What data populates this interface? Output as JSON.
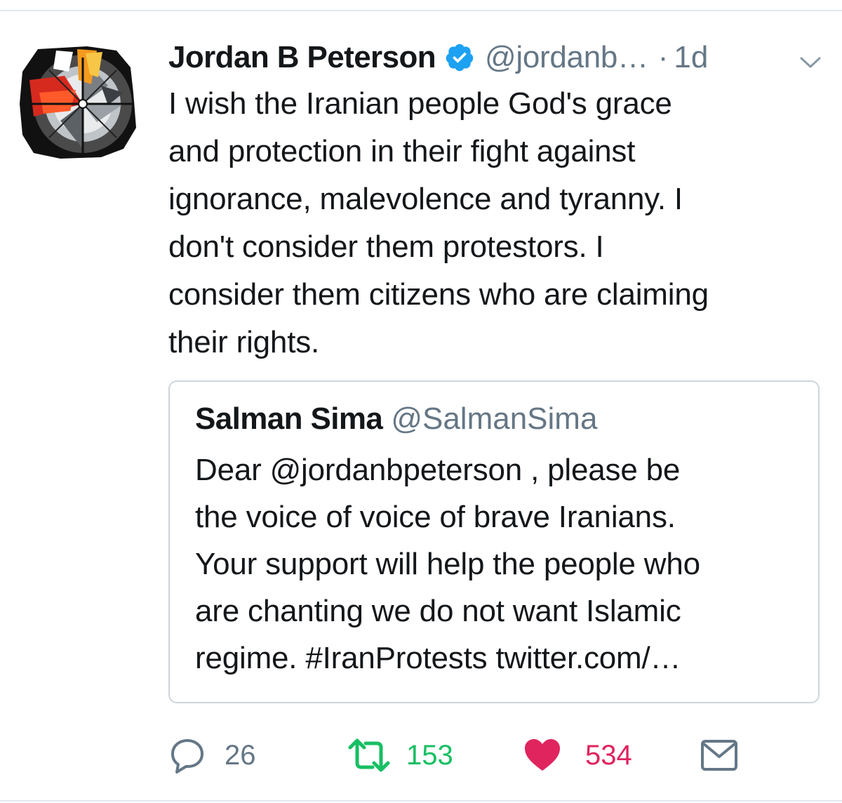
{
  "tweet": {
    "author_name": "Jordan B Peterson",
    "verified": true,
    "handle": "@jordanb…",
    "separator": "·",
    "time": "1d",
    "text_lines": [
      "I wish the Iranian people God's grace",
      "and protection in their fight against",
      "ignorance, malevolence and tyranny. I",
      "don't consider them protestors. I",
      "consider them citizens who are claiming",
      "their rights."
    ]
  },
  "quoted_tweet": {
    "author_name": "Salman Sima",
    "handle": "@SalmanSima",
    "text_lines": [
      "Dear @jordanbpeterson , please be",
      "the voice of voice of brave Iranians.",
      "Your support will help the people who",
      "are chanting we do not want Islamic",
      "regime.  #IranProtests twitter.com/…"
    ]
  },
  "actions": {
    "replies": "26",
    "retweets": "153",
    "likes": "534"
  },
  "colors": {
    "text": "#14171a",
    "secondary": "#657786",
    "verified_blue": "#1da1f2",
    "retweet_green": "#17bf63",
    "like_red": "#e0245e",
    "border": "#ccd6dd"
  },
  "icons": [
    "verified-badge-icon",
    "chevron-down-icon",
    "reply-icon",
    "retweet-icon",
    "heart-icon",
    "envelope-icon"
  ]
}
